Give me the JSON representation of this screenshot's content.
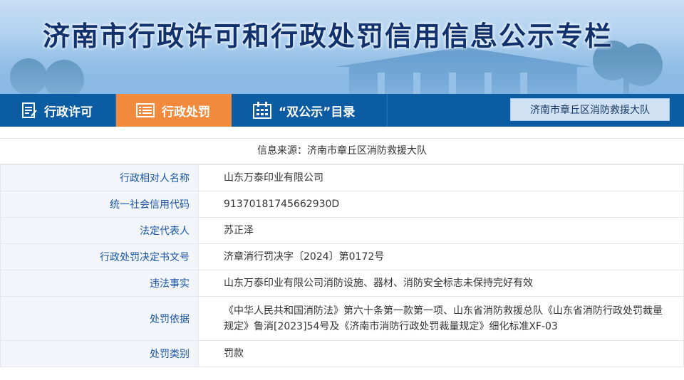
{
  "banner": {
    "title": "济南市行政许可和行政处罚信用信息公示专栏"
  },
  "nav": {
    "items": [
      {
        "label": "行政许可",
        "icon": "document-icon",
        "active": false
      },
      {
        "label": "行政处罚",
        "icon": "list-icon",
        "active": true
      },
      {
        "label": "“双公示”目录",
        "icon": "calendar-icon",
        "active": false
      }
    ],
    "agency_button": "济南市章丘区消防救援大队"
  },
  "colors": {
    "nav_bg": "#0b5ca3",
    "nav_active": "#f18a3c",
    "key_text": "#1a56a6"
  },
  "detail": {
    "source": "信息来源：济南市章丘区消防救援大队",
    "rows": [
      {
        "key": "行政相对人名称",
        "value": "山东万泰印业有限公司"
      },
      {
        "key": "统一社会信用代码",
        "value": "91370181745662930D"
      },
      {
        "key": "法定代表人",
        "value": "苏正泽"
      },
      {
        "key": "行政处罚决定书文号",
        "value": "济章消行罚决字〔2024〕第0172号"
      },
      {
        "key": "违法事实",
        "value": "山东万泰印业有限公司消防设施、器材、消防安全标志未保持完好有效"
      },
      {
        "key": "处罚依据",
        "value": "《中华人民共和国消防法》第六十条第一款第一项、山东省消防救援总队《山东省消防行政处罚裁量规定》鲁消[2023]54号及《济南市消防行政处罚裁量规定》细化标准XF-03"
      },
      {
        "key": "处罚类别",
        "value": "罚款"
      }
    ]
  }
}
